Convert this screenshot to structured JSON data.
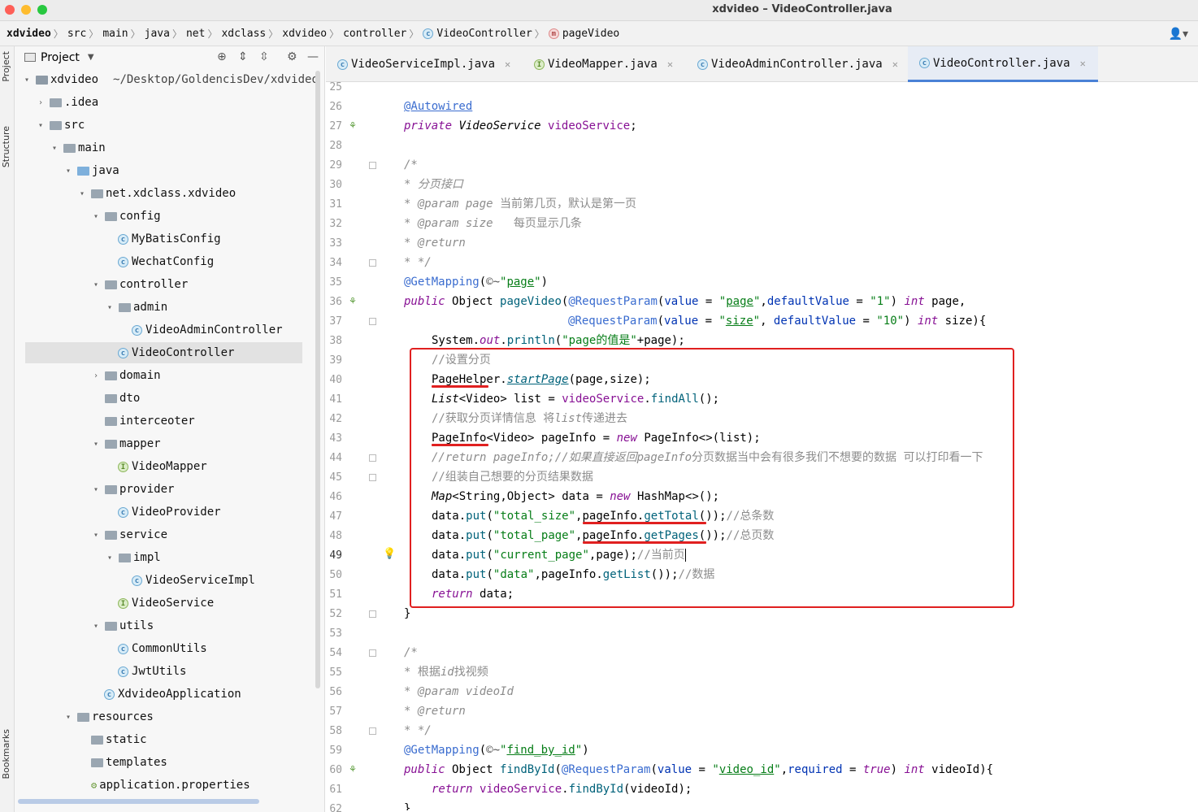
{
  "window": {
    "title": "xdvideo – VideoController.java"
  },
  "breadcrumb": [
    "xdvideo",
    "src",
    "main",
    "java",
    "net",
    "xdclass",
    "xdvideo",
    "controller",
    "VideoController",
    "pageVideo"
  ],
  "tool_strip": {
    "project": "Project",
    "structure": "Structure",
    "bookmarks": "Bookmarks"
  },
  "project": {
    "header": "Project",
    "root_name": "xdvideo",
    "root_path": "~/Desktop/GoldencisDev/xdvideo",
    "tree": [
      {
        "label": ".idea"
      },
      {
        "label": "src"
      },
      {
        "label": "main"
      },
      {
        "label": "java"
      },
      {
        "label": "net.xdclass.xdvideo"
      },
      {
        "label": "config"
      },
      {
        "label": "MyBatisConfig"
      },
      {
        "label": "WechatConfig"
      },
      {
        "label": "controller"
      },
      {
        "label": "admin"
      },
      {
        "label": "VideoAdminController"
      },
      {
        "label": "VideoController"
      },
      {
        "label": "domain"
      },
      {
        "label": "dto"
      },
      {
        "label": "interceoter"
      },
      {
        "label": "mapper"
      },
      {
        "label": "VideoMapper"
      },
      {
        "label": "provider"
      },
      {
        "label": "VideoProvider"
      },
      {
        "label": "service"
      },
      {
        "label": "impl"
      },
      {
        "label": "VideoServiceImpl"
      },
      {
        "label": "VideoService"
      },
      {
        "label": "utils"
      },
      {
        "label": "CommonUtils"
      },
      {
        "label": "JwtUtils"
      },
      {
        "label": "XdvideoApplication"
      },
      {
        "label": "resources"
      },
      {
        "label": "static"
      },
      {
        "label": "templates"
      },
      {
        "label": "application.properties"
      }
    ]
  },
  "tabs": [
    {
      "label": "VideoServiceImpl.java"
    },
    {
      "label": "VideoMapper.java"
    },
    {
      "label": "VideoAdminController.java"
    },
    {
      "label": "VideoController.java"
    }
  ],
  "editor": {
    "line_numbers": [
      "25",
      "26",
      "27",
      "28",
      "29",
      "30",
      "31",
      "32",
      "33",
      "34",
      "35",
      "36",
      "37",
      "38",
      "39",
      "40",
      "41",
      "42",
      "43",
      "44",
      "45",
      "46",
      "47",
      "48",
      "49",
      "50",
      "51",
      "52",
      "53",
      "54",
      "55",
      "56",
      "57",
      "58",
      "59",
      "60",
      "61",
      "62"
    ],
    "current_line": "49",
    "strings": {
      "autowired": "@Autowired",
      "private_kw": "private",
      "VideoService": "VideoService",
      "videoService_field": "videoService",
      "slash_star": "/*",
      "c30": "* 分页接口",
      "c31_a": "* @param",
      "c31_b": "page",
      "c31_c": "当前第几页，默认是第一页",
      "c32_a": "* @param",
      "c32_b": "size",
      "c32_c": "  每页显示几条",
      "c33": "* @return",
      "c34": "* */",
      "getmapping": "@GetMapping",
      "page_str": "page",
      "public_kw": "public",
      "object_type": "Object",
      "pageVideo": "pageVideo",
      "requestparam": "@RequestParam",
      "value_kw": "value",
      "dv_kw": "defaultValue",
      "one": "\"1\"",
      "int_kw": "int",
      "size_str": "size",
      "ten": "\"10\"",
      "system": "System",
      "out": "out",
      "println": "println",
      "page_is": "\"page的值是\"",
      "c39": "//设置分页",
      "pagehelper": "PageHelper",
      "startpage": "startPage",
      "list_type": "List",
      "video": "Video",
      "list_var": "list",
      "findall": "findAll",
      "c42": "//获取分页详情信息 将",
      "c42_b": "list",
      "c42_c": "传递进去",
      "pageinfo_cls": "PageInfo",
      "pageinfo_var": "pageInfo",
      "new_kw": "new",
      "pageinfo_diamond": "PageInfo<>",
      "c44_a": "//return pageInfo;//如果直接返回",
      "c44_b": "pageInfo",
      "c44_c": "分页数据当中会有很多我们不想要的数据 可以打印看一下",
      "c45": "//组装自己想要的分页结果数据",
      "map_type": "Map",
      "string_type": "String",
      "data_var": "data",
      "hashmap": "HashMap<>",
      "put": "put",
      "total_size": "\"total_size\"",
      "gettotal": "getTotal",
      "c47": "//总条数",
      "total_page": "\"total_page\"",
      "getpages": "getPages",
      "c48": "//总页数",
      "current_page": "\"current_page\"",
      "c49": "//当前页",
      "data_str": "\"data\"",
      "getlist": "getList",
      "c50": "//数据",
      "return_kw": "return",
      "c55_a": "* 根据",
      "c55_b": "id",
      "c55_c": "找视频",
      "c56_a": "* @param",
      "c56_b": "videoId",
      "find_by_id": "find_by_id",
      "findbyid": "findById",
      "video_id": "video_id",
      "required_kw": "required",
      "true_kw": "true",
      "videoid_var": "videoId"
    }
  },
  "colors": {
    "highlight_box": "#e02020",
    "accent": "#4a81d6"
  }
}
